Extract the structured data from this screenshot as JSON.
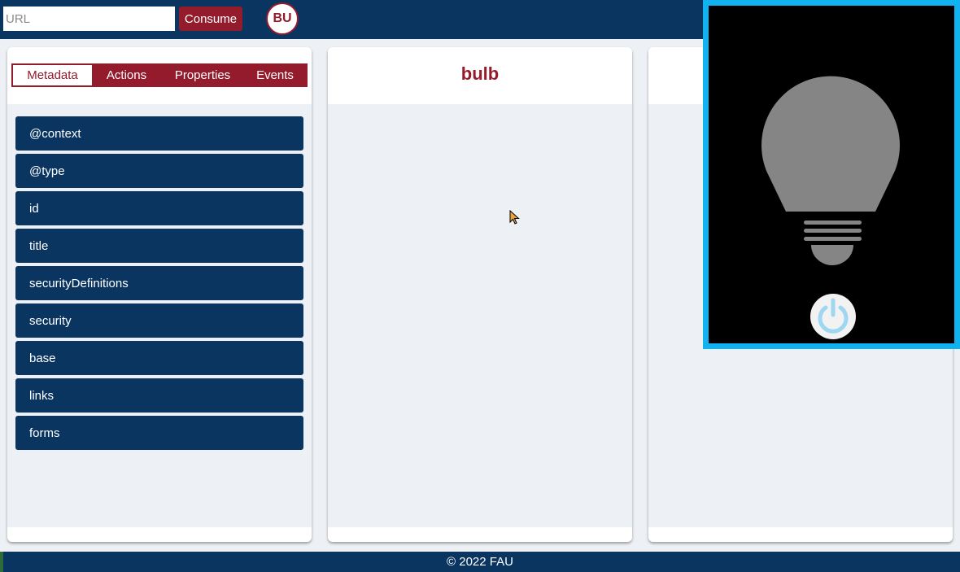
{
  "header": {
    "url_placeholder": "URL",
    "url_value": "",
    "consume_label": "Consume",
    "avatar_initials": "BU"
  },
  "left_panel": {
    "tabs": [
      "Metadata",
      "Actions",
      "Properties",
      "Events"
    ],
    "active_tab": "Metadata",
    "metadata_items": [
      "@context",
      "@type",
      "id",
      "title",
      "securityDefinitions",
      "security",
      "base",
      "links",
      "forms"
    ]
  },
  "center_panel": {
    "title": "bulb"
  },
  "bulb_widget": {
    "state": "off",
    "icon": "lightbulb-icon",
    "power_icon": "power-icon",
    "colors": {
      "border": "#10b2f0",
      "bulb_off": "#858585",
      "power_ring": "#9fd6f0"
    }
  },
  "footer": {
    "text": "© 2022 FAU"
  },
  "colors": {
    "navy": "#0b3561",
    "maroon": "#941b2c",
    "panel_bg": "#edf0f4"
  }
}
